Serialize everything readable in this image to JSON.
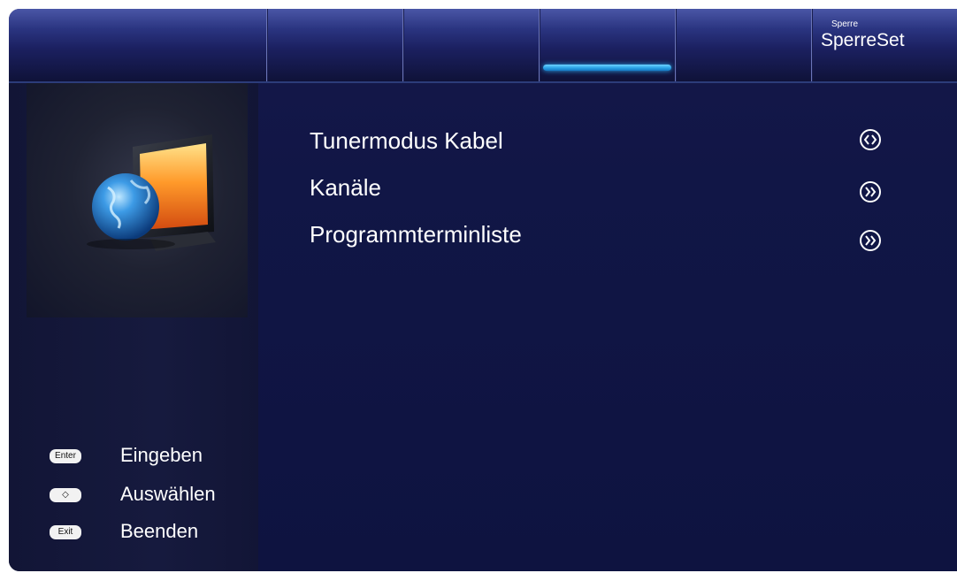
{
  "tabs": [
    {
      "label": ""
    },
    {
      "label": ""
    },
    {
      "label": ""
    },
    {
      "label": "",
      "selected": true
    },
    {
      "label": ""
    },
    {
      "label": "SperreSet",
      "small_label": "Sperre"
    }
  ],
  "menu": {
    "items": [
      {
        "label": "Tunermodus Kabel",
        "icon": "left-right-arrows-icon"
      },
      {
        "label": "Kanäle",
        "icon": "double-chevron-right-icon"
      },
      {
        "label": "Programmterminliste",
        "icon": "double-chevron-right-icon"
      }
    ]
  },
  "hints": [
    {
      "key": "Enter",
      "label": "Eingeben"
    },
    {
      "key": "◇",
      "label": "Auswählen"
    },
    {
      "key": "Exit",
      "label": "Beenden"
    }
  ],
  "side": {
    "image": "tv-globe-icon"
  },
  "colors": {
    "background": "#111646",
    "accent": "#2aa3e6",
    "text": "#ffffff"
  }
}
